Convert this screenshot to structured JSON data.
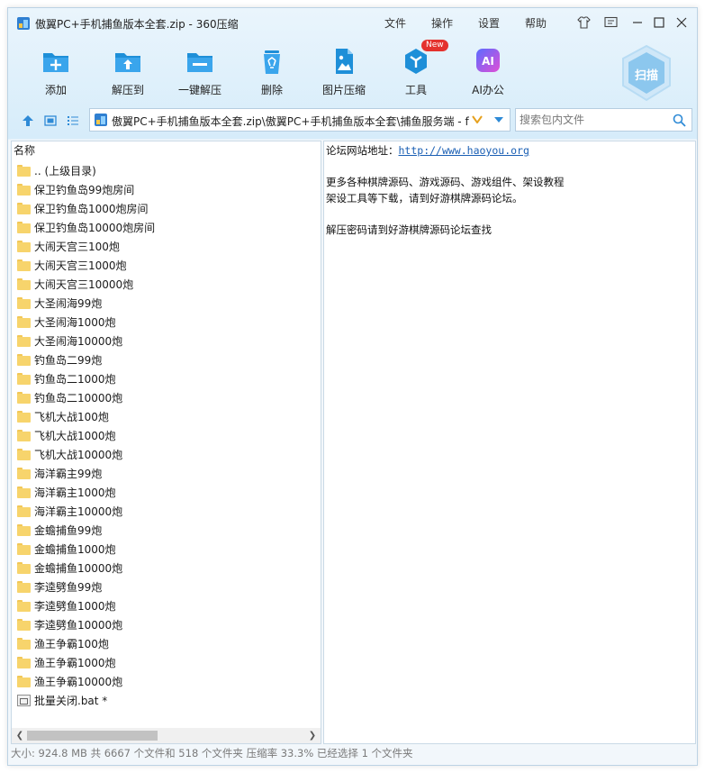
{
  "title_bar": {
    "title": "傲翼PC+手机捕鱼版本全套.zip - 360压缩",
    "menus": [
      "文件",
      "操作",
      "设置",
      "帮助"
    ]
  },
  "toolbar": {
    "add": "添加",
    "extract_to": "解压到",
    "one_click_extract": "一键解压",
    "delete": "删除",
    "image_compress": "图片压缩",
    "tools": "工具",
    "tools_badge": "New",
    "ai_office": "AI办公",
    "ai_icon_text": "AI",
    "scan": "扫描"
  },
  "address": {
    "path": "傲翼PC+手机捕鱼版本全套.zip\\傲翼PC+手机捕鱼版本全套\\捕鱼服务端 - f"
  },
  "search": {
    "placeholder": "搜索包内文件"
  },
  "file_list": {
    "column_header": "名称",
    "items": [
      ".. (上级目录)",
      "保卫钓鱼岛99炮房间",
      "保卫钓鱼岛1000炮房间",
      "保卫钓鱼岛10000炮房间",
      "大闹天宫三100炮",
      "大闹天宫三1000炮",
      "大闹天宫三10000炮",
      "大圣闹海99炮",
      "大圣闹海1000炮",
      "大圣闹海10000炮",
      "钓鱼岛二99炮",
      "钓鱼岛二1000炮",
      "钓鱼岛二10000炮",
      "飞机大战100炮",
      "飞机大战1000炮",
      "飞机大战10000炮",
      "海洋霸主99炮",
      "海洋霸主1000炮",
      "海洋霸主10000炮",
      "金蟾捕鱼99炮",
      "金蟾捕鱼1000炮",
      "金蟾捕鱼10000炮",
      "李逵劈鱼99炮",
      "李逵劈鱼1000炮",
      "李逵劈鱼10000炮",
      "渔王争霸100炮",
      "渔王争霸1000炮",
      "渔王争霸10000炮"
    ],
    "file_item": "批量关闭.bat *"
  },
  "preview": {
    "line1_label": "论坛网站地址：",
    "line1_link": "http://www.haoyou.org",
    "line2": "更多各种棋牌源码、游戏源码、游戏组件、架设教程",
    "line3": "架设工具等下载，请到好游棋牌源码论坛。",
    "line4": "解压密码请到好游棋牌源码论坛查找"
  },
  "status": {
    "text": "大小: 924.8 MB 共 6667 个文件和 518 个文件夹 压缩率 33.3% 已经选择 1 个文件夹"
  },
  "colors": {
    "accent": "#1e8fd8",
    "badge_red": "#e4312d",
    "folder_yellow": "#f7d46c"
  }
}
